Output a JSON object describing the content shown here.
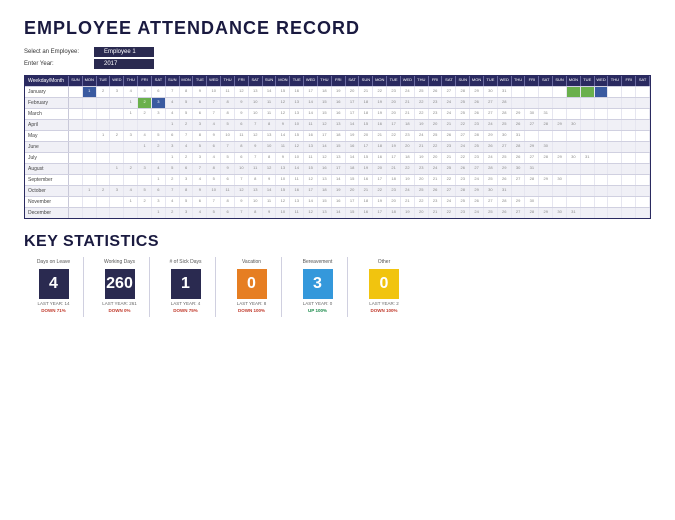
{
  "title": "EMPLOYEE ATTENDANCE RECORD",
  "controls": {
    "employee_label": "Select an Employee:",
    "employee_value": "Employee 1",
    "year_label": "Enter Year:",
    "year_value": "2017"
  },
  "grid": {
    "corner": "Weekday/Month",
    "days": [
      "SUN",
      "MON",
      "TUE",
      "WED",
      "THU",
      "FRI",
      "SAT",
      "SUN",
      "MON",
      "TUE",
      "WED",
      "THU",
      "FRI",
      "SAT",
      "SUN",
      "MON",
      "TUE",
      "WED",
      "THU",
      "FRI",
      "SAT",
      "SUN",
      "MON",
      "TUE",
      "WED",
      "THU",
      "FRI",
      "SAT",
      "SUN",
      "MON",
      "TUE",
      "WED",
      "THU",
      "FRI",
      "SAT",
      "SUN",
      "MON",
      "TUE",
      "WED",
      "THU",
      "FRI",
      "SAT"
    ],
    "months": [
      "January",
      "February",
      "March",
      "April",
      "May",
      "June",
      "July",
      "August",
      "September",
      "October",
      "November",
      "December"
    ],
    "offsets": [
      1,
      4,
      4,
      7,
      2,
      5,
      7,
      3,
      6,
      1,
      4,
      6
    ],
    "lengths": [
      31,
      28,
      31,
      30,
      31,
      30,
      31,
      31,
      30,
      31,
      30,
      31
    ],
    "highlights": {
      "0": {
        "1": "b",
        "36": "g",
        "37": "g",
        "38": "b"
      },
      "1": {
        "5": "g",
        "6": "b"
      }
    }
  },
  "stats_title": "KEY STATISTICS",
  "stats": [
    {
      "label": "Days on Leave",
      "value": "4",
      "color": "#2a2a50",
      "last": "LAST YEAR: 14",
      "change": "DOWN 71%",
      "chg_color": "#c0392b"
    },
    {
      "label": "Working Days",
      "value": "260",
      "color": "#2a2a50",
      "last": "LAST YEAR: 261",
      "change": "DOWN 0%",
      "chg_color": "#c0392b"
    },
    {
      "label": "# of Sick Days",
      "value": "1",
      "color": "#2a2a50",
      "last": "LAST YEAR: 4",
      "change": "DOWN 75%",
      "chg_color": "#c0392b"
    },
    {
      "label": "Vacation",
      "value": "0",
      "color": "#e67e22",
      "last": "LAST YEAR: 8",
      "change": "DOWN 100%",
      "chg_color": "#c0392b"
    },
    {
      "label": "Bereavement",
      "value": "3",
      "color": "#3498db",
      "last": "LAST YEAR: 0",
      "change": "UP 100%",
      "chg_color": "#1a8a4a"
    },
    {
      "label": "Other",
      "value": "0",
      "color": "#f1c40f",
      "last": "LAST YEAR: 2",
      "change": "DOWN 100%",
      "chg_color": "#c0392b"
    }
  ]
}
